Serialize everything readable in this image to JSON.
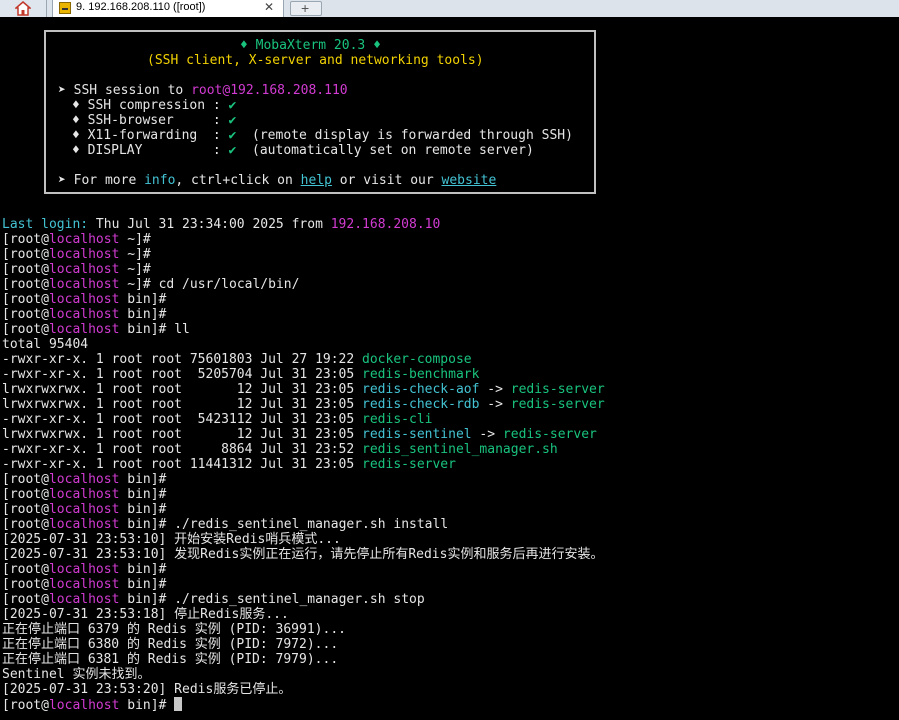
{
  "tab": {
    "title": "9. 192.168.208.110 ([root])",
    "close": "✕",
    "new_tab": "+"
  },
  "banner": {
    "title": "MobaXterm 20.3",
    "subtitle": "(SSH client, X-server and networking tools)",
    "session_prefix": "➤ SSH session to ",
    "session_user": "root",
    "session_host": "@192.168.208.110",
    "features": [
      {
        "label": "SSH compression : ",
        "check": "✔",
        "note": ""
      },
      {
        "label": "SSH-browser     : ",
        "check": "✔",
        "note": ""
      },
      {
        "label": "X11-forwarding  : ",
        "check": "✔",
        "note": "  (remote display is forwarded through SSH)"
      },
      {
        "label": "DISPLAY         : ",
        "check": "✔",
        "note": "  (automatically set on remote server)"
      }
    ],
    "more_prefix": "➤ For more ",
    "more_info": "info",
    "more_mid": ", ctrl+click on ",
    "more_help": "help",
    "more_mid2": " or visit our ",
    "more_website": "website"
  },
  "last_login": {
    "label": "Last login:",
    "text": " Thu Jul 31 23:34:00 2025 from ",
    "ip": "192.168.208.10"
  },
  "prompt": {
    "open": "[root@",
    "host": "localhost",
    "dir_home": " ~]# ",
    "dir_bin": " bin]# "
  },
  "commands": {
    "cd": "cd /usr/local/bin/",
    "ll": "ll",
    "install": "./redis_sentinel_manager.sh install",
    "stop": "./redis_sentinel_manager.sh stop"
  },
  "ls": {
    "total": "total 95404",
    "rows": [
      {
        "meta": "-rwxr-xr-x. 1 root root 75601803 Jul 27 19:22 ",
        "name": "docker-compose",
        "arrow": "",
        "target": ""
      },
      {
        "meta": "-rwxr-xr-x. 1 root root  5205704 Jul 31 23:05 ",
        "name": "redis-benchmark",
        "arrow": "",
        "target": ""
      },
      {
        "meta": "lrwxrwxrwx. 1 root root       12 Jul 31 23:05 ",
        "name": "redis-check-aof",
        "arrow": " -> ",
        "target": "redis-server"
      },
      {
        "meta": "lrwxrwxrwx. 1 root root       12 Jul 31 23:05 ",
        "name": "redis-check-rdb",
        "arrow": " -> ",
        "target": "redis-server"
      },
      {
        "meta": "-rwxr-xr-x. 1 root root  5423112 Jul 31 23:05 ",
        "name": "redis-cli",
        "arrow": "",
        "target": ""
      },
      {
        "meta": "lrwxrwxrwx. 1 root root       12 Jul 31 23:05 ",
        "name": "redis-sentinel",
        "arrow": " -> ",
        "target": "redis-server"
      },
      {
        "meta": "-rwxr-xr-x. 1 root root     8864 Jul 31 23:52 ",
        "name": "redis_sentinel_manager.sh",
        "arrow": "",
        "target": ""
      },
      {
        "meta": "-rwxr-xr-x. 1 root root 11441312 Jul 31 23:05 ",
        "name": "redis-server",
        "arrow": "",
        "target": ""
      }
    ]
  },
  "output": {
    "install_1": "[2025-07-31 23:53:10] 开始安装Redis哨兵模式...",
    "install_2": "[2025-07-31 23:53:10] 发现Redis实例正在运行，请先停止所有Redis实例和服务后再进行安装。",
    "stop_1": "[2025-07-31 23:53:18] 停止Redis服务...",
    "stop_2": "正在停止端口 6379 的 Redis 实例 (PID: 36991)...",
    "stop_3": "正在停止端口 6380 的 Redis 实例 (PID: 7972)...",
    "stop_4": "正在停止端口 6381 的 Redis 实例 (PID: 7979)...",
    "stop_5": "Sentinel 实例未找到。",
    "stop_6": "[2025-07-31 23:53:20] Redis服务已停止。"
  },
  "colors": {
    "green": "#19c37d",
    "yellow": "#f2d200",
    "magenta": "#d23bd2",
    "cyan": "#43c3d3",
    "text": "#e6e6e6",
    "background": "#000000"
  }
}
